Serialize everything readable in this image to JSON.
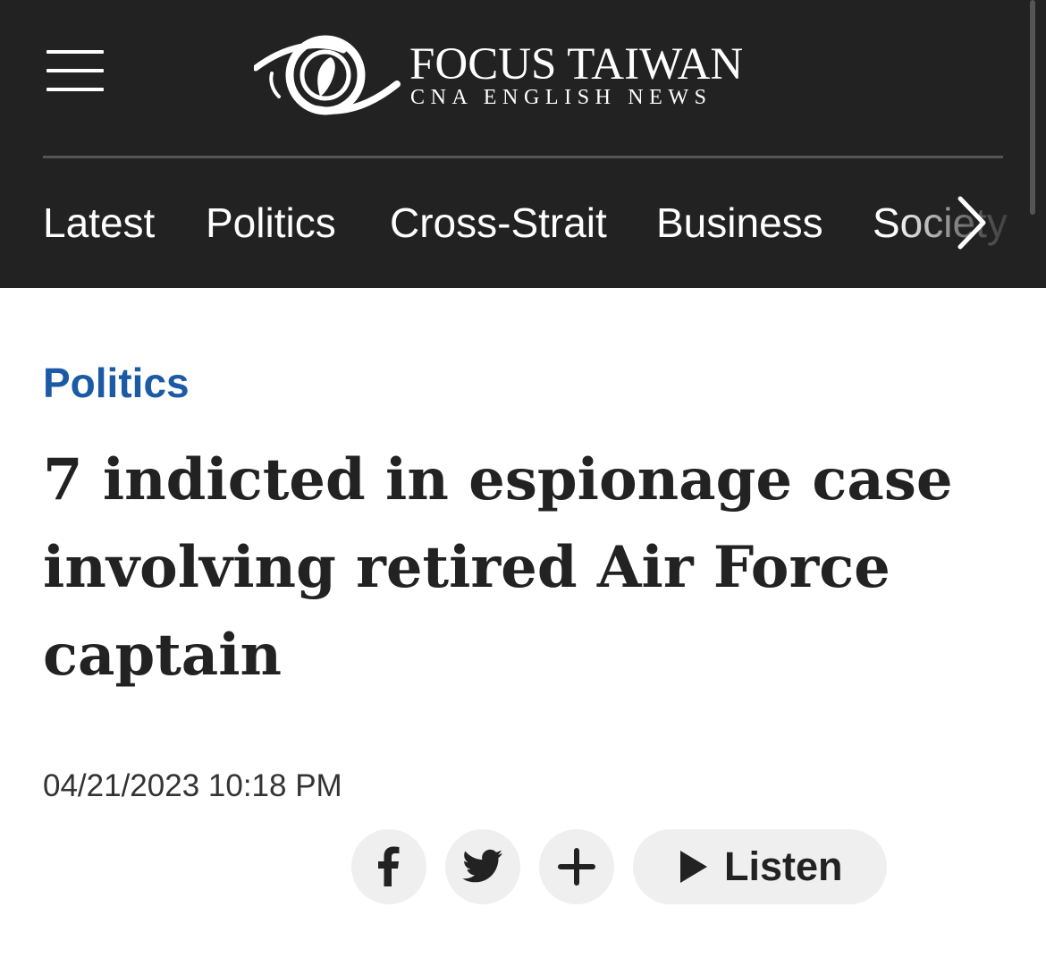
{
  "header": {
    "brand_name": "FOCUS TAIWAN",
    "brand_sub": "CNA ENGLISH NEWS",
    "menu_icon": "hamburger-icon",
    "logo_icon": "eye-taiwan-logo",
    "next_icon": "chevron-right-icon",
    "background": "#222222"
  },
  "nav": {
    "items": [
      {
        "label": "Latest"
      },
      {
        "label": "Politics"
      },
      {
        "label": "Cross-Strait"
      },
      {
        "label": "Business"
      },
      {
        "label": "Society"
      }
    ]
  },
  "article": {
    "category": "Politics",
    "category_color": "#1c5aa6",
    "headline": "7 indicted in espionage case involving retired Air Force captain",
    "timestamp": "04/21/2023 10:18 PM"
  },
  "share": {
    "facebook_icon": "facebook-icon",
    "twitter_icon": "twitter-icon",
    "more_icon": "plus-icon",
    "listen_icon": "play-icon",
    "listen_label": "Listen"
  }
}
